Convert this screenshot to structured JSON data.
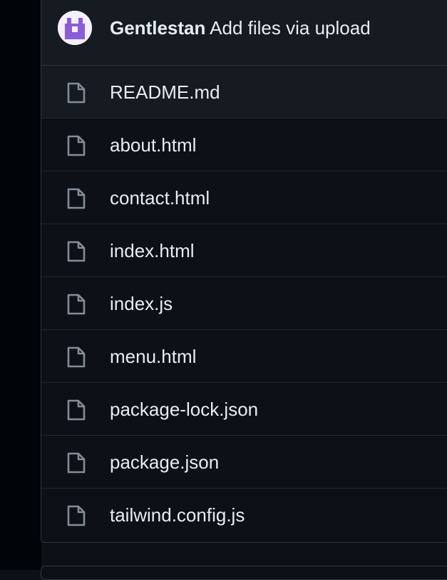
{
  "commit": {
    "author": "Gentlestan",
    "message": "Add files via upload"
  },
  "files": [
    {
      "name": "README.md",
      "icon": "file-icon"
    },
    {
      "name": "about.html",
      "icon": "file-icon"
    },
    {
      "name": "contact.html",
      "icon": "file-icon"
    },
    {
      "name": "index.html",
      "icon": "file-icon"
    },
    {
      "name": "index.js",
      "icon": "file-icon"
    },
    {
      "name": "menu.html",
      "icon": "file-icon"
    },
    {
      "name": "package-lock.json",
      "icon": "file-icon"
    },
    {
      "name": "package.json",
      "icon": "file-icon"
    },
    {
      "name": "tailwind.config.js",
      "icon": "file-icon"
    }
  ],
  "colors": {
    "background": "#0d1117",
    "header_background": "#161b22",
    "border": "#30363d",
    "text": "#e6edf3",
    "icon": "#848d97",
    "avatar_accent": "#8b5cd6"
  }
}
